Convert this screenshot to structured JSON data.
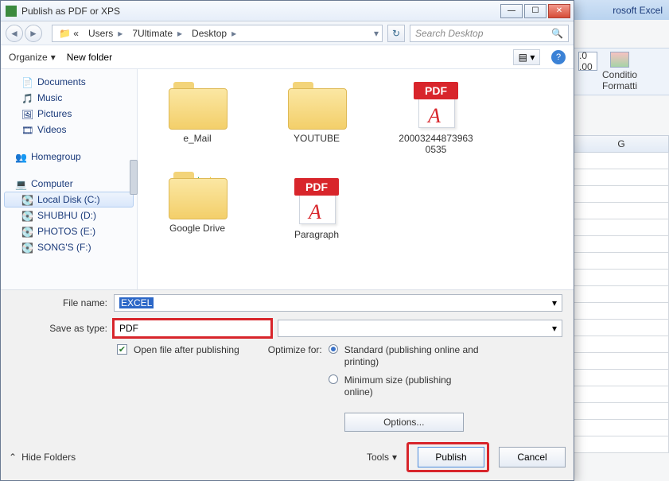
{
  "excel_bg": {
    "brand": "rosoft Excel",
    "conditional": "Conditio",
    "formatting": "Formatti",
    "decimals": ".0  .00",
    "col_label": "G"
  },
  "dialog": {
    "title": "Publish as PDF or XPS",
    "breadcrumb": [
      "Users",
      "7Ultimate",
      "Desktop"
    ],
    "search_placeholder": "Search Desktop",
    "organize": "Organize",
    "new_folder": "New folder"
  },
  "sidebar": {
    "items": [
      {
        "label": "Documents",
        "icon": "doc"
      },
      {
        "label": "Music",
        "icon": "music"
      },
      {
        "label": "Pictures",
        "icon": "pic"
      },
      {
        "label": "Videos",
        "icon": "vid"
      }
    ],
    "homegroup": "Homegroup",
    "computer": "Computer",
    "drives": [
      {
        "label": "Local Disk (C:)",
        "selected": true
      },
      {
        "label": "SHUBHU (D:)",
        "selected": false
      },
      {
        "label": "PHOTOS (E:)",
        "selected": false
      },
      {
        "label": "SONG'S (F:)",
        "selected": false
      }
    ]
  },
  "files": [
    {
      "label": "e_Mail",
      "kind": "folder"
    },
    {
      "label": "YOUTUBE",
      "kind": "folder"
    },
    {
      "label": "20003244873963\n0535",
      "kind": "pdf"
    },
    {
      "label": "Google Drive",
      "kind": "gdrive"
    },
    {
      "label": "Paragraph",
      "kind": "pdf"
    }
  ],
  "form": {
    "filename_label": "File name:",
    "filename_value": "EXCEL",
    "saveas_label": "Save as type:",
    "saveas_value": "PDF",
    "open_after": "Open file after publishing",
    "optimize_label": "Optimize for:",
    "opt_standard": "Standard (publishing online and printing)",
    "opt_min": "Minimum size (publishing online)",
    "options": "Options...",
    "hide_folders": "Hide Folders",
    "tools": "Tools",
    "publish": "Publish",
    "cancel": "Cancel"
  }
}
